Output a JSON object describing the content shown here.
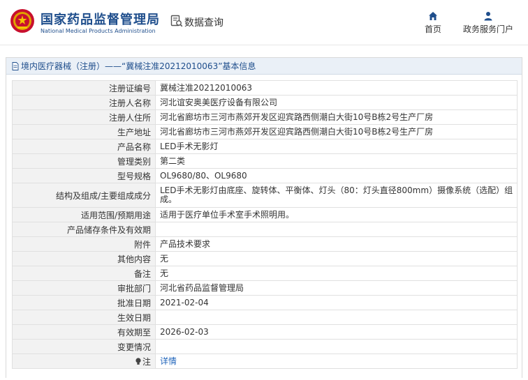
{
  "header": {
    "brand_cn": "国家药品监督管理局",
    "brand_en": "National Medical Products Administration",
    "query_title": "数据查询",
    "nav": [
      {
        "label": "首页",
        "icon": "home-icon"
      },
      {
        "label": "政务服务门户",
        "icon": "user-icon"
      }
    ]
  },
  "panel": {
    "title": "境内医疗器械（注册）——“冀械注准20212010063”基本信息"
  },
  "rows": [
    {
      "label": "注册证编号",
      "value": "冀械注准20212010063"
    },
    {
      "label": "注册人名称",
      "value": "河北谊安奥美医疗设备有限公司"
    },
    {
      "label": "注册人住所",
      "value": "河北省廊坊市三河市燕郊开发区迎宾路西侧潮白大街10号B栋2号生产厂房"
    },
    {
      "label": "生产地址",
      "value": "河北省廊坊市三河市燕郊开发区迎宾路西侧潮白大街10号B栋2号生产厂房"
    },
    {
      "label": "产品名称",
      "value": "LED手术无影灯"
    },
    {
      "label": "管理类别",
      "value": "第二类"
    },
    {
      "label": "型号规格",
      "value": "OL9680/80、OL9680"
    },
    {
      "label": "结构及组成/主要组成成分",
      "value": "LED手术无影灯由底座、旋转体、平衡体、灯头（80：灯头直径800mm）摄像系统（选配）组成。"
    },
    {
      "label": "适用范围/预期用途",
      "value": "适用于医疗单位手术室手术照明用。"
    },
    {
      "label": "产品储存条件及有效期",
      "value": ""
    },
    {
      "label": "附件",
      "value": "产品技术要求"
    },
    {
      "label": "其他内容",
      "value": "无"
    },
    {
      "label": "备注",
      "value": "无"
    },
    {
      "label": "审批部门",
      "value": "河北省药品监督管理局"
    },
    {
      "label": "批准日期",
      "value": "2021-02-04"
    },
    {
      "label": "生效日期",
      "value": ""
    },
    {
      "label": "有效期至",
      "value": "2026-02-03"
    },
    {
      "label": "变更情况",
      "value": ""
    }
  ],
  "note_row": {
    "label": "注",
    "value": "详情",
    "icon": "lightbulb-icon"
  },
  "colors": {
    "brand": "#1f4e8c",
    "label_bg": "#f2f2f2",
    "title_bg": "#eaf0f7",
    "link": "#2266bb"
  }
}
